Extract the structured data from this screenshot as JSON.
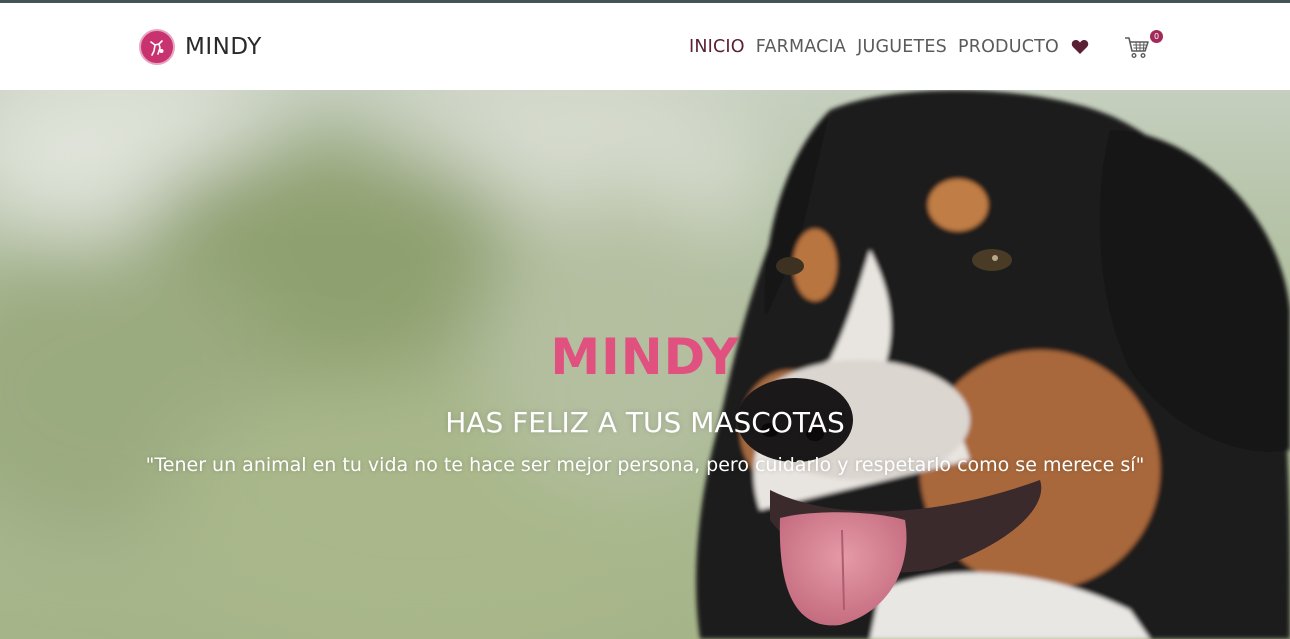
{
  "navbar": {
    "brand": {
      "name": "MINDY",
      "logo_icon": "pet-logo-icon"
    },
    "links": [
      {
        "label": "INICIO",
        "active": true
      },
      {
        "label": "FARMACIA",
        "active": false
      },
      {
        "label": "JUGUETES",
        "active": false
      },
      {
        "label": "PRODUCTO",
        "active": false
      }
    ],
    "wishlist_icon": "heart-icon",
    "cart_icon": "shopping-cart-icon",
    "cart_count": "0"
  },
  "hero": {
    "title": "MINDY",
    "subtitle": "HAS FELIZ A TUS MASCOTAS",
    "quote": "\"Tener un animal en tu vida no te hace ser mejor persona, pero cuidarlo y respetarlo como se merece sí\"",
    "image": "dog-photo"
  },
  "colors": {
    "accent": "#e0517f",
    "active_link": "#5a2134",
    "badge": "#a12a5b",
    "logo": "#c8336f"
  }
}
